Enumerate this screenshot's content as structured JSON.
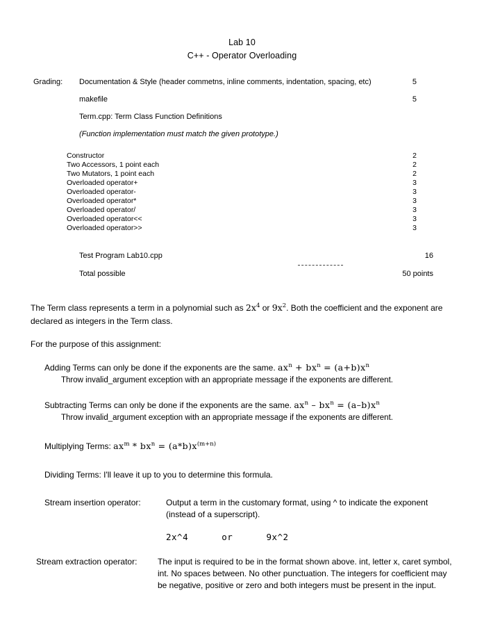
{
  "document": {
    "title_lines": [
      "Lab 10",
      "C++  -  Operator Overloading"
    ]
  },
  "grading": {
    "label": "Grading:",
    "rows": [
      {
        "text": "Documentation & Style (header commetns, inline comments, indentation, spacing, etc)",
        "points": "5",
        "italic": false
      },
      {
        "text": "makefile",
        "points": "5",
        "italic": false
      },
      {
        "text": "Term.cpp:   Term Class Function Definitions",
        "points": "",
        "italic": false
      },
      {
        "text": "(Function implementation must match the given prototype.)",
        "points": "",
        "italic": true
      }
    ],
    "subitems": [
      {
        "name": "Constructor",
        "points": "2"
      },
      {
        "name": "Two Accessors, 1 point each",
        "points": "2"
      },
      {
        "name": "Two Mutators, 1 point each",
        "points": "2"
      },
      {
        "name": "Overloaded operator+",
        "points": "3"
      },
      {
        "name": "Overloaded operator-",
        "points": "3"
      },
      {
        "name": "Overloaded operator*",
        "points": "3"
      },
      {
        "name": "Overloaded operator/",
        "points": "3"
      },
      {
        "name": "Overloaded operator<<",
        "points": "3"
      },
      {
        "name": "Overloaded operator>>",
        "points": "3"
      }
    ],
    "totals": [
      {
        "name": "Test Program Lab10.cpp",
        "value": "16"
      },
      {
        "name": "Total possible",
        "value": "50 points"
      }
    ]
  },
  "body": {
    "intro_part1": "The Term class represents a term in a polynomial such as ",
    "intro_math1_base": "2x",
    "intro_math1_exp": "4",
    "intro_part2": " or ",
    "intro_math2_base": "9x",
    "intro_math2_exp": "2",
    "intro_part3": ".  Both the coefficient and the exponent are declared as integers in the Term class.",
    "purpose_heading": "For the purpose of this assignment:",
    "rules": [
      {
        "main_text": "Adding Terms can only be done if the exponents are the same.  ",
        "formula_a_base": "ax",
        "formula_a_exp": "n",
        "formula_op": " + ",
        "formula_b_base": "bx",
        "formula_b_exp": "n",
        "formula_eq": " = ",
        "formula_r_base": "(a+b)x",
        "formula_r_exp": "n",
        "sub_text": "Throw invalid_argument exception with an appropriate message if the exponents are different."
      },
      {
        "main_text": "Subtracting Terms can only be done if the exponents are the same.  ",
        "formula_a_base": "ax",
        "formula_a_exp": "n",
        "formula_op": " – ",
        "formula_b_base": "bx",
        "formula_b_exp": "n",
        "formula_eq": " = ",
        "formula_r_base": "(a–b)x",
        "formula_r_exp": "n",
        "sub_text": "Throw invalid_argument exception with an appropriate message if the exponents are different."
      }
    ],
    "multiplying": {
      "label": "Multiplying Terms:  ",
      "formula_a_base": "ax",
      "formula_a_exp": "m",
      "formula_op": " * ",
      "formula_b_base": "bx",
      "formula_b_exp": "n",
      "formula_eq": " = ",
      "formula_r_base": "(a*b)x",
      "formula_r_exp": "(m+n)"
    },
    "dividing": "Dividing Terms:  I'll leave it up to you to determine this formula.",
    "stream_insertion": {
      "label": "Stream insertion operator:",
      "description": "Output a term in the customary format, using ^ to indicate the exponent (instead of a superscript).",
      "example": "2x^4      or      9x^2"
    },
    "stream_extraction": {
      "label": "Stream extraction operator:",
      "description": "The input is required to be in the format shown above.  int, letter x, caret symbol, int.   No spaces between.   No other punctuation.  The integers for coefficient may be negative, positive or zero and both integers must be present in the input."
    }
  }
}
